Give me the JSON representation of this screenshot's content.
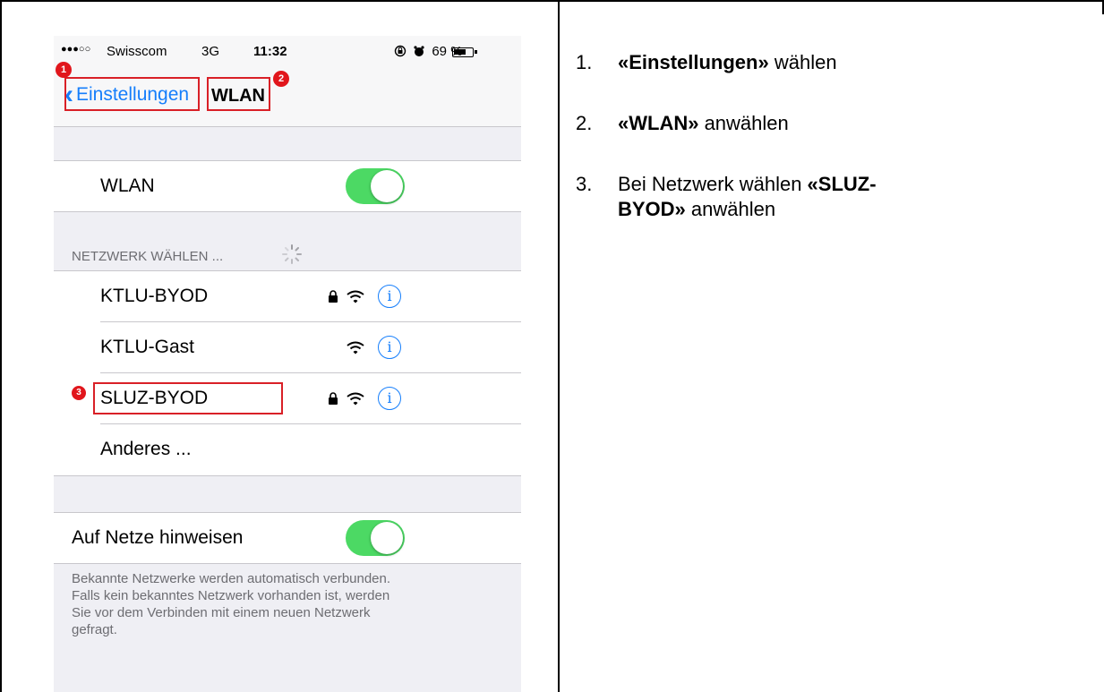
{
  "status_bar": {
    "signal": "●●●○○",
    "carrier": "Swisscom",
    "network": "3G",
    "time": "11:32",
    "battery": "69 %",
    "battery_level": 0.69
  },
  "nav": {
    "back_label": "Einstellungen",
    "title": "WLAN"
  },
  "badges": [
    "1",
    "2",
    "3"
  ],
  "wlan_row": {
    "label": "WLAN",
    "on": true
  },
  "network_section": {
    "header": "NETZWERK WÄHLEN ...",
    "networks": [
      {
        "name": "KTLU-BYOD",
        "locked": true
      },
      {
        "name": "KTLU-Gast",
        "locked": false
      },
      {
        "name": "SLUZ-BYOD",
        "locked": true
      }
    ],
    "other": "Anderes ..."
  },
  "ask_row": {
    "label": "Auf Netze hinweisen",
    "on": true
  },
  "footer": "Bekannte Netzwerke werden automatisch verbunden. Falls kein bekanntes Netzwerk vorhanden ist, werden Sie vor dem Verbinden mit einem neuen Netzwerk gefragt.",
  "steps": [
    {
      "num": "1.",
      "bold": "«Einstellungen»",
      "after": " wählen",
      "before": ""
    },
    {
      "num": "2.",
      "bold": "«WLAN»",
      "after": " anwählen",
      "before": ""
    },
    {
      "num": "3.",
      "before": "Bei Netzwerk wählen ",
      "bold": "«SLUZ-BYOD»",
      "after": " anwählen"
    }
  ],
  "colors": {
    "accent": "#157efb",
    "toggle_on": "#4cd964",
    "annotation_red": "#d92027"
  }
}
